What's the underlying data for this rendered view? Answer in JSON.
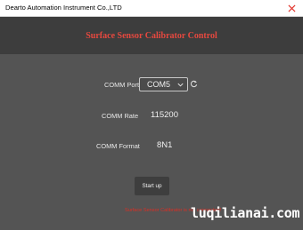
{
  "window": {
    "title": "Dearto Automation Instrument Co.,LTD",
    "close_icon": "close-icon"
  },
  "header": {
    "title": "Surface Sensor Calibrator Control",
    "title_color": "#e6483f",
    "background": "#3d3d3d"
  },
  "form": {
    "comm_port": {
      "label": "COMM Port",
      "selected": "COM5",
      "dropdown_icon": "chevron-down-icon",
      "refresh_icon": "refresh-icon"
    },
    "comm_rate": {
      "label": "COMM Rate",
      "value": "115200"
    },
    "comm_format": {
      "label": "COMM Format",
      "value": "8N1"
    }
  },
  "actions": {
    "start_label": "Start up"
  },
  "status": {
    "text": "Surface Sensor Calibrator is not connected!",
    "color": "#dc2e24"
  },
  "watermark": {
    "text": "luqilianai.com"
  }
}
